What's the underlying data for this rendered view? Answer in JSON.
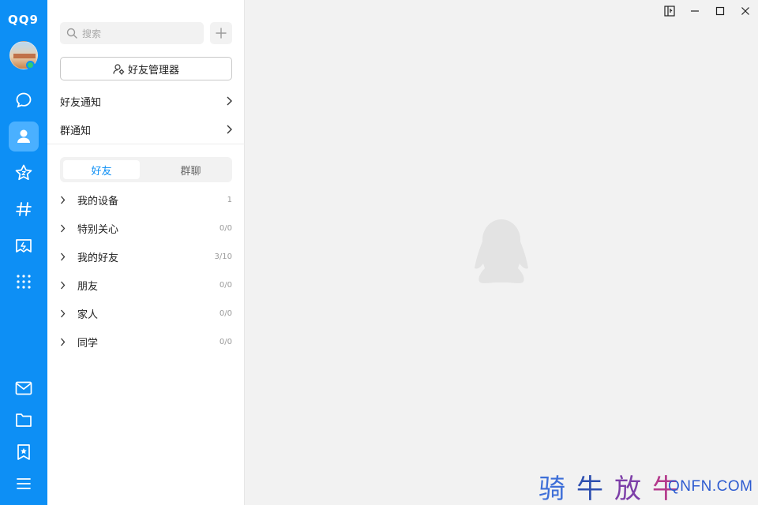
{
  "app": {
    "logo_text": "QQ9"
  },
  "rail": {
    "top_icons": [
      "chat-bubble-icon",
      "contacts-icon",
      "star-icon",
      "hashtag-icon",
      "game-icon",
      "apps-grid-icon"
    ],
    "bottom_icons": [
      "mail-icon",
      "folder-icon",
      "bookmark-icon",
      "menu-icon"
    ],
    "active": "contacts-icon"
  },
  "search": {
    "placeholder": "搜索"
  },
  "friend_manager": {
    "label": "好友管理器"
  },
  "notices": [
    {
      "label": "好友通知"
    },
    {
      "label": "群通知"
    }
  ],
  "tabs": [
    {
      "label": "好友",
      "active": true
    },
    {
      "label": "群聊",
      "active": false
    }
  ],
  "groups": [
    {
      "name": "我的设备",
      "count": "1"
    },
    {
      "name": "特别关心",
      "count": "0/0"
    },
    {
      "name": "我的好友",
      "count": "3/10"
    },
    {
      "name": "朋友",
      "count": "0/0"
    },
    {
      "name": "家人",
      "count": "0/0"
    },
    {
      "name": "同学",
      "count": "0/0"
    }
  ],
  "watermark": {
    "chars": [
      "骑",
      "牛",
      "放",
      "牛"
    ],
    "domain": "QNFN.COM"
  },
  "colors": {
    "accent": "#0d8ff5",
    "active_tab": "#0d8ff5",
    "background": "#f2f2f2"
  }
}
